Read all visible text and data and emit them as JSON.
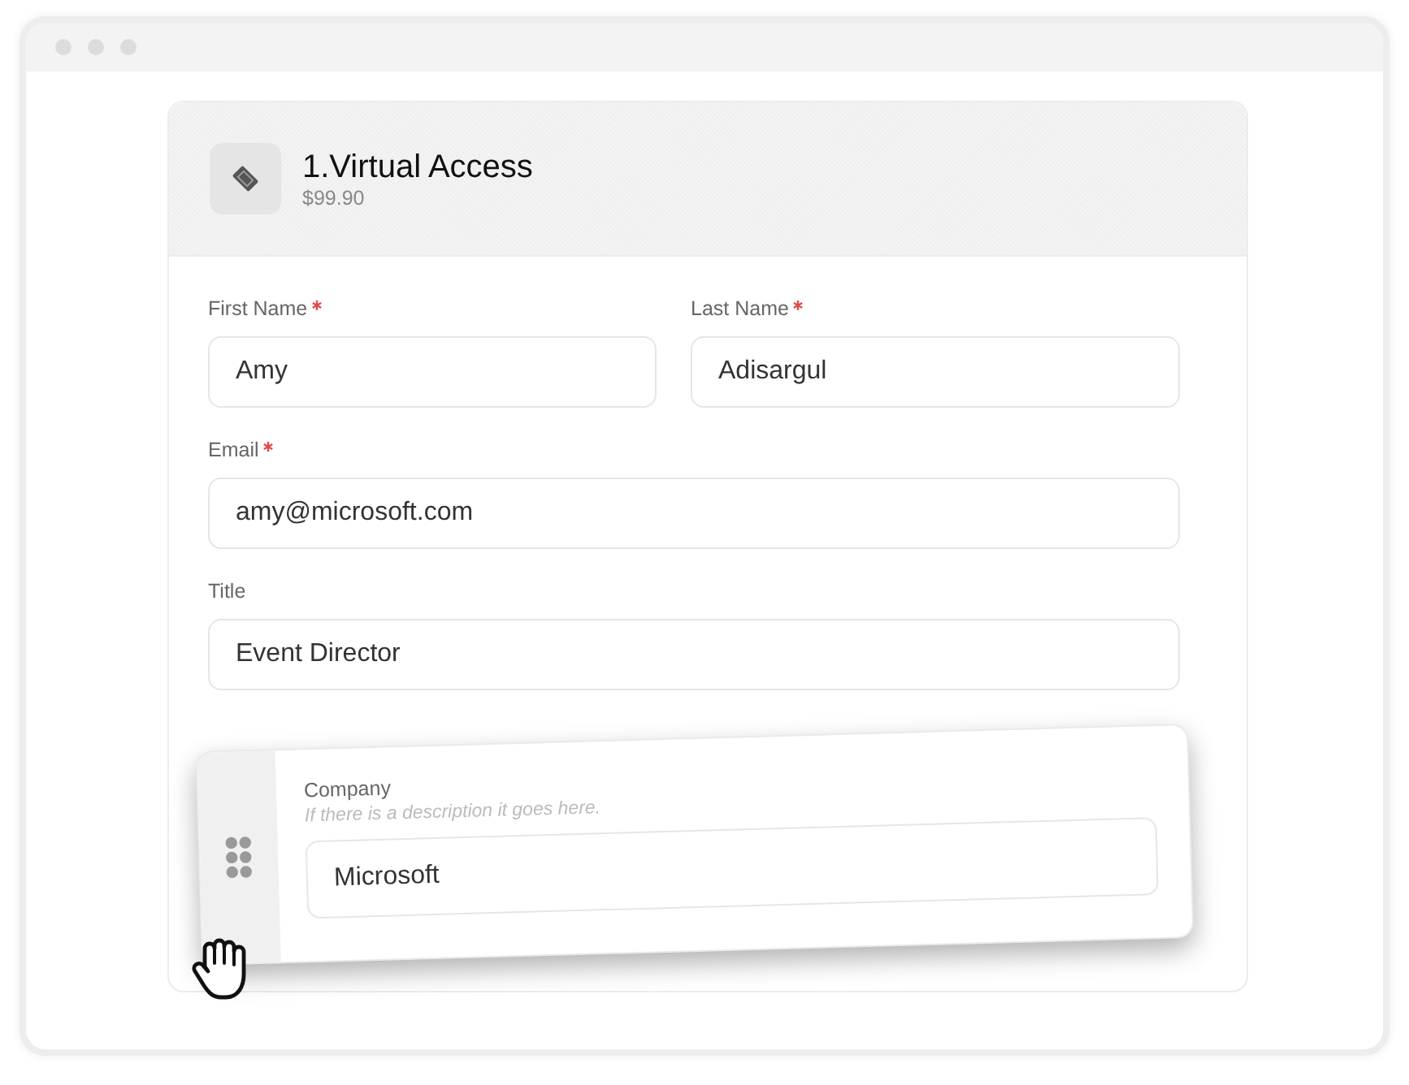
{
  "ticket": {
    "title": "1.Virtual Access",
    "price": "$99.90"
  },
  "form": {
    "rows": [
      [
        {
          "label": "First Name",
          "required": true,
          "value": "Amy"
        },
        {
          "label": "Last Name",
          "required": true,
          "value": "Adisargul"
        }
      ],
      [
        {
          "label": "Email",
          "required": true,
          "value": "amy@microsoft.com"
        }
      ],
      [
        {
          "label": "Title",
          "required": false,
          "value": "Event Director"
        }
      ]
    ]
  },
  "dragged_field": {
    "label": "Company",
    "description": "If there is a description it goes here.",
    "value": "Microsoft",
    "dragging": true
  }
}
